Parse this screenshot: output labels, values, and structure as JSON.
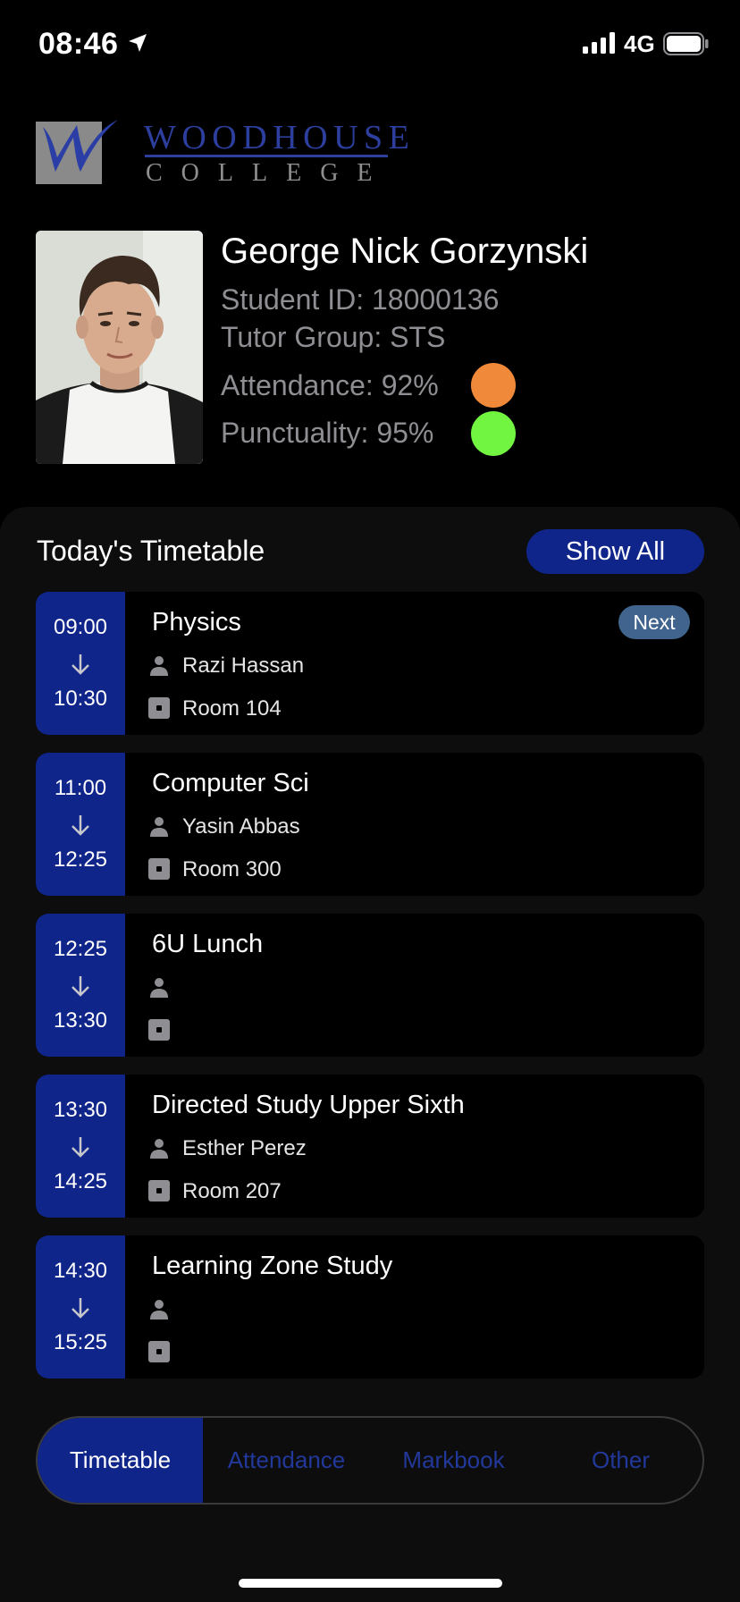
{
  "status_bar": {
    "time": "08:46",
    "network": "4G",
    "icons": [
      "location-arrow-icon",
      "signal-icon",
      "battery-icon"
    ]
  },
  "logo": {
    "line1": "WOODHOUSE",
    "line2": "COLLEGE"
  },
  "profile": {
    "name": "George Nick Gorzynski",
    "student_id": "Student ID: 18000136",
    "tutor_group": "Tutor Group: STS",
    "attendance": "Attendance: 92%",
    "attendance_color": "#f0893a",
    "punctuality": "Punctuality: 95%",
    "punctuality_color": "#72f541"
  },
  "timetable": {
    "title": "Today's Timetable",
    "show_all_label": "Show All",
    "next_label": "Next",
    "lessons": [
      {
        "start": "09:00",
        "end": "10:30",
        "subject": "Physics",
        "teacher": "Razi Hassan",
        "room": "Room 104"
      },
      {
        "start": "11:00",
        "end": "12:25",
        "subject": "Computer Sci",
        "teacher": "Yasin Abbas",
        "room": "Room 300"
      },
      {
        "start": "12:25",
        "end": "13:30",
        "subject": "6U Lunch",
        "teacher": "",
        "room": ""
      },
      {
        "start": "13:30",
        "end": "14:25",
        "subject": "Directed Study Upper Sixth",
        "teacher": "Esther Perez",
        "room": "Room 207"
      },
      {
        "start": "14:30",
        "end": "15:25",
        "subject": "Learning Zone Study",
        "teacher": "",
        "room": ""
      }
    ]
  },
  "tabs": {
    "timetable": "Timetable",
    "attendance": "Attendance",
    "markbook": "Markbook",
    "other": "Other",
    "active": "Timetable",
    "active_color": "#10258a"
  }
}
